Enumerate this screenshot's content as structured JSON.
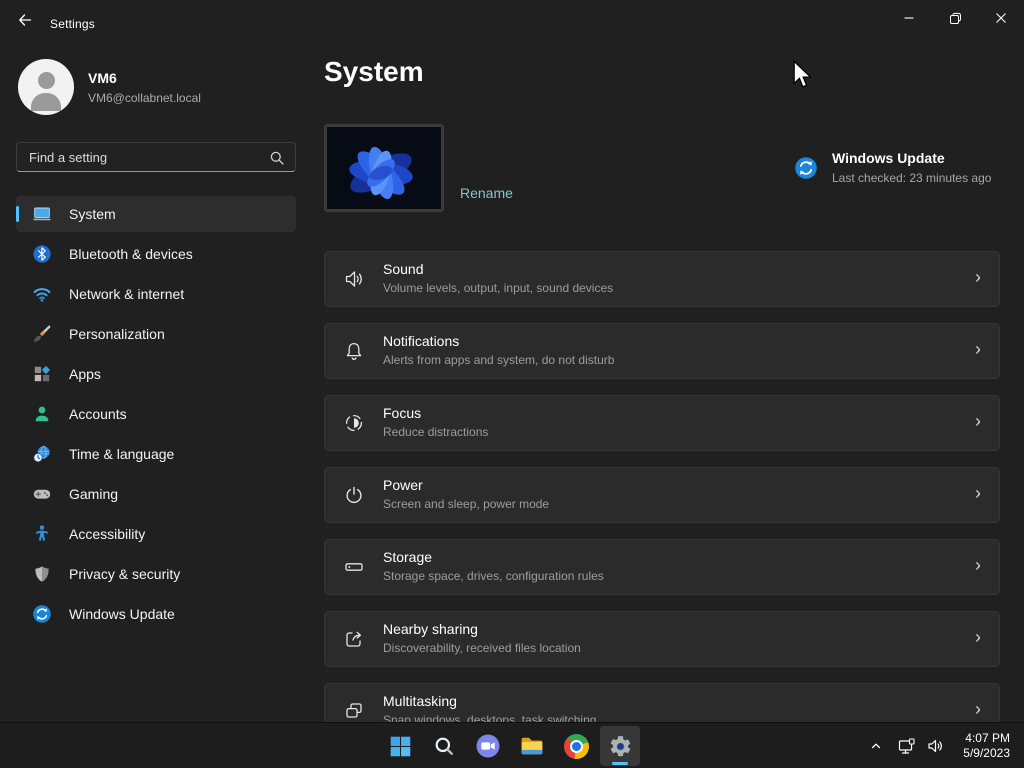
{
  "window": {
    "title": "Settings",
    "controls": {
      "minimize": "minimize",
      "restore": "restore",
      "close": "close"
    }
  },
  "profile": {
    "name": "VM6",
    "email": "VM6@collabnet.local"
  },
  "search": {
    "placeholder": "Find a setting"
  },
  "sidebar": {
    "items": [
      {
        "label": "System",
        "icon": "system-icon",
        "selected": true
      },
      {
        "label": "Bluetooth & devices",
        "icon": "bluetooth-icon",
        "selected": false
      },
      {
        "label": "Network & internet",
        "icon": "network-icon",
        "selected": false
      },
      {
        "label": "Personalization",
        "icon": "personalization-icon",
        "selected": false
      },
      {
        "label": "Apps",
        "icon": "apps-icon",
        "selected": false
      },
      {
        "label": "Accounts",
        "icon": "accounts-icon",
        "selected": false
      },
      {
        "label": "Time & language",
        "icon": "time-icon",
        "selected": false
      },
      {
        "label": "Gaming",
        "icon": "gaming-icon",
        "selected": false
      },
      {
        "label": "Accessibility",
        "icon": "accessibility-icon",
        "selected": false
      },
      {
        "label": "Privacy & security",
        "icon": "privacy-icon",
        "selected": false
      },
      {
        "label": "Windows Update",
        "icon": "update-icon",
        "selected": false
      }
    ]
  },
  "main": {
    "page_title": "System",
    "device": {
      "rename_label": "Rename"
    },
    "windows_update": {
      "title": "Windows Update",
      "status": "Last checked: 23 minutes ago"
    },
    "cards": [
      {
        "title": "Sound",
        "subtitle": "Volume levels, output, input, sound devices",
        "icon": "speaker-icon"
      },
      {
        "title": "Notifications",
        "subtitle": "Alerts from apps and system, do not disturb",
        "icon": "bell-icon"
      },
      {
        "title": "Focus",
        "subtitle": "Reduce distractions",
        "icon": "focus-icon"
      },
      {
        "title": "Power",
        "subtitle": "Screen and sleep, power mode",
        "icon": "power-icon"
      },
      {
        "title": "Storage",
        "subtitle": "Storage space, drives, configuration rules",
        "icon": "storage-icon"
      },
      {
        "title": "Nearby sharing",
        "subtitle": "Discoverability, received files location",
        "icon": "share-icon"
      },
      {
        "title": "Multitasking",
        "subtitle": "Snap windows, desktops, task switching",
        "icon": "multitask-icon"
      }
    ],
    "chevron_glyph": "›"
  },
  "taskbar": {
    "buttons": [
      {
        "name": "start",
        "icon": "start-icon",
        "active": false
      },
      {
        "name": "search",
        "icon": "taskbar-search-icon",
        "active": false
      },
      {
        "name": "chat",
        "icon": "chat-icon",
        "active": false
      },
      {
        "name": "file-explorer",
        "icon": "explorer-icon",
        "active": false
      },
      {
        "name": "chrome",
        "icon": "chrome-icon",
        "active": false
      },
      {
        "name": "settings",
        "icon": "settings-gear-icon",
        "active": true
      }
    ],
    "tray": {
      "time": "4:07 PM",
      "date": "5/9/2023"
    }
  },
  "colors": {
    "accent": "#4cc2ff",
    "link": "#86c5cf",
    "card_bg": "#2b2b2b",
    "window_bg": "#202020"
  }
}
